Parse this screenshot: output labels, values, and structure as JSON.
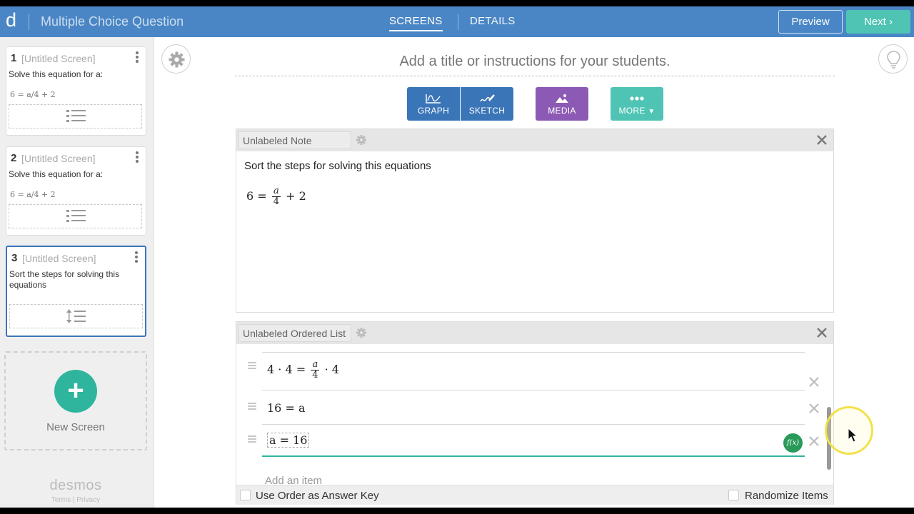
{
  "topbar": {
    "logo": "d",
    "title": "Multiple Choice Question",
    "tabs": [
      "SCREENS",
      "DETAILS"
    ],
    "preview_label": "Preview",
    "next_label": "Next ›"
  },
  "sidebar": {
    "screens": [
      {
        "num": "1",
        "title": "[Untitled Screen]",
        "text": "Solve this equation for a:",
        "eq": "6 = a/4 + 2"
      },
      {
        "num": "2",
        "title": "[Untitled Screen]",
        "text": "Solve this equation for a:",
        "eq": "6 = a/4 + 2"
      },
      {
        "num": "3",
        "title": "[Untitled Screen]",
        "text": "Sort the steps for solving this equations",
        "eq": ""
      }
    ],
    "new_screen": "New Screen",
    "brand": "desmos",
    "legal": "Terms | Privacy"
  },
  "main": {
    "instructions_placeholder": "Add a title or instructions for your students.",
    "tools": [
      "GRAPH",
      "SKETCH",
      "MEDIA",
      "MORE"
    ]
  },
  "note": {
    "label": "Unlabeled Note",
    "text": "Sort the steps for solving this equations",
    "eq_lhs": "6 =",
    "eq_num": "a",
    "eq_den": "4",
    "eq_rhs": "+ 2"
  },
  "ordered_list": {
    "label": "Unlabeled Ordered List",
    "items": [
      {
        "lhs": "4 · 4 =",
        "num": "a",
        "den": "4",
        "rhs": "· 4"
      },
      {
        "text": "16 = a"
      },
      {
        "text": "a = 16"
      }
    ],
    "fx_label": "f(x)",
    "add_item_placeholder": "Add an item",
    "use_order_label": "Use Order as Answer Key",
    "randomize_label": "Randomize Items",
    "use_order_checked": false,
    "randomize_checked": false
  },
  "colors": {
    "topbar": "#4a86c5",
    "next": "#4fc4b4",
    "graph": "#3a75b8",
    "media": "#8c5ab4",
    "more": "#4fc4b4",
    "new_screen": "#2fb59e"
  }
}
